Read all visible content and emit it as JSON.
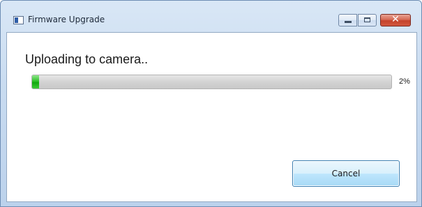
{
  "window": {
    "title": "Firmware Upgrade",
    "controls": {
      "minimize": "minimize",
      "maximize": "maximize",
      "close": "close"
    }
  },
  "dialog": {
    "status_text": "Uploading to camera..",
    "progress": {
      "percent_label": "2%",
      "value_percent": 2,
      "fill_color": "#22b51d"
    },
    "cancel_label": "Cancel"
  },
  "icons": {
    "app": "app-window-icon",
    "close": "✕"
  }
}
